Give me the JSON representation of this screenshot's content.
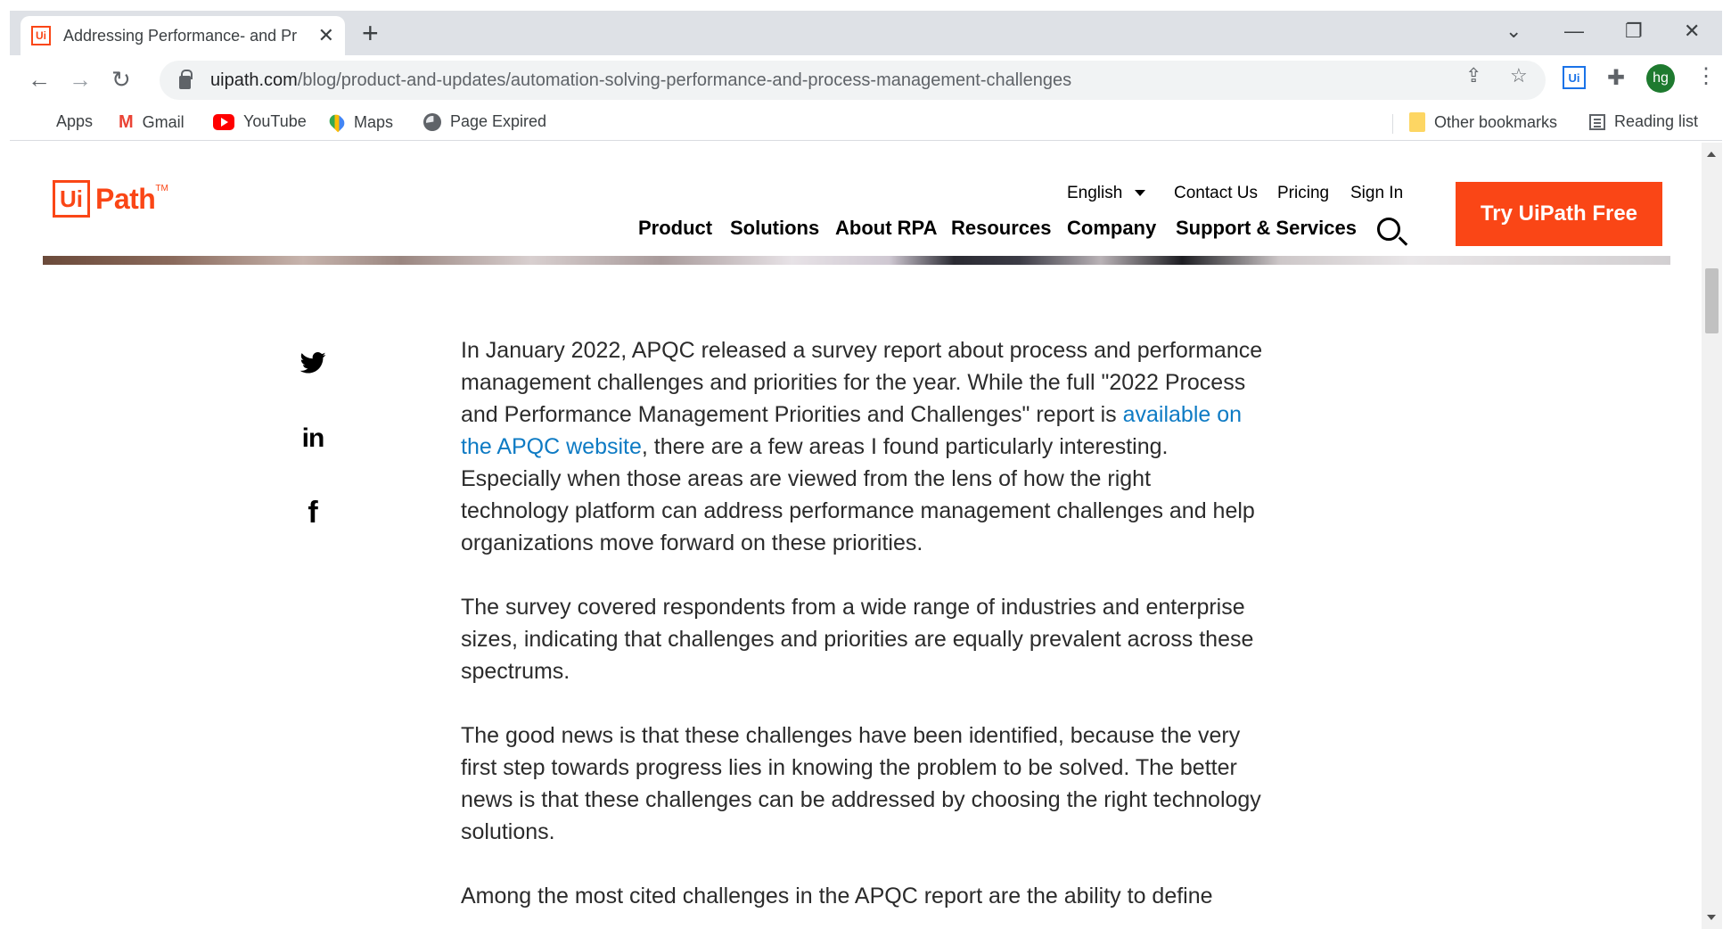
{
  "browser": {
    "tab": {
      "title": "Addressing Performance- and Pr",
      "favicon": "Ui"
    },
    "window_controls": [
      "minimize",
      "restore",
      "close"
    ],
    "url": {
      "host": "uipath.com",
      "path": "/blog/product-and-updates/automation-solving-performance-and-process-management-challenges"
    },
    "extension_label": "Ui",
    "profile_initials": "hg",
    "bookmarks": [
      {
        "label": "Apps",
        "icon": "apps-icon"
      },
      {
        "label": "Gmail",
        "icon": "gmail-icon"
      },
      {
        "label": "YouTube",
        "icon": "youtube-icon"
      },
      {
        "label": "Maps",
        "icon": "maps-icon"
      },
      {
        "label": "Page Expired",
        "icon": "globe-icon"
      }
    ],
    "other_bookmarks": "Other bookmarks",
    "reading_list": "Reading list"
  },
  "site": {
    "logo": {
      "box": "Ui",
      "text": "Path",
      "tm": "TM"
    },
    "language": "English",
    "utility_nav": [
      "Contact Us",
      "Pricing",
      "Sign In"
    ],
    "main_nav": [
      "Product",
      "Solutions",
      "About RPA",
      "Resources",
      "Company",
      "Support & Services"
    ],
    "cta": "Try UiPath Free",
    "colors": {
      "brand": "#fa4616",
      "link": "#0e7bc4"
    }
  },
  "share": [
    "twitter-icon",
    "linkedin-icon",
    "facebook-icon"
  ],
  "article": {
    "p1_before": "In January 2022, APQC released a survey report about process and performance management challenges and priorities for the year. While the full \"2022 Process and Performance Management Priorities and Challenges\" report is ",
    "p1_link": "available on the APQC website",
    "p1_after": ", there are a few areas I found particularly interesting. Especially when those areas are viewed from the lens of how the right technology platform can address performance management challenges and help organizations move forward on these priorities.",
    "p2": "The survey covered respondents from a wide range of industries and enterprise sizes, indicating that challenges and priorities are equally prevalent across these spectrums.",
    "p3": "The good news is that these challenges have been identified, because the very first step towards progress lies in knowing the problem to be solved. The better news is that these challenges can be addressed by choosing the right technology solutions.",
    "p4": "Among the most cited challenges in the APQC report are the ability to define"
  }
}
